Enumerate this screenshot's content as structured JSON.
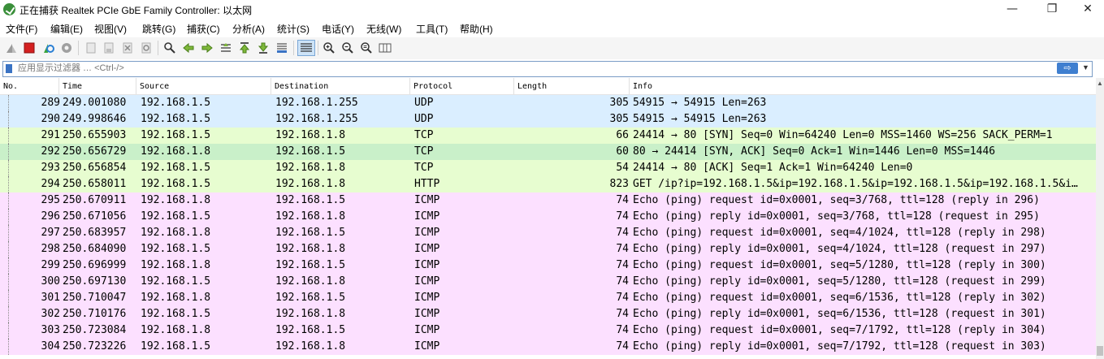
{
  "window": {
    "title": "正在捕获 Realtek PCIe GbE Family Controller: 以太网",
    "minimize_glyph": "—",
    "maximize_glyph": "❐",
    "close_glyph": "✕"
  },
  "menubar": {
    "items": [
      "文件(F)",
      "编辑(E)",
      "视图(V)",
      "跳转(G)",
      "捕获(C)",
      "分析(A)",
      "统计(S)",
      "电话(Y)",
      "无线(W)",
      "工具(T)",
      "帮助(H)"
    ]
  },
  "toolbar": {
    "icons": [
      "shark-fin-start-icon",
      "stop-capture-icon",
      "restart-capture-icon",
      "capture-options-icon",
      "open-file-icon",
      "save-file-icon",
      "close-file-icon",
      "reload-file-icon",
      "find-packet-icon",
      "go-back-icon",
      "go-forward-icon",
      "go-to-packet-icon",
      "go-first-icon",
      "go-last-icon",
      "auto-scroll-icon",
      "colorize-icon",
      "zoom-in-icon",
      "zoom-out-icon",
      "zoom-normal-icon",
      "resize-columns-icon"
    ]
  },
  "filter": {
    "placeholder": "应用显示过滤器 … <Ctrl-/>",
    "apply_glyph": "⇨",
    "dropdown_glyph": "▼"
  },
  "packet_list": {
    "columns": [
      "No.",
      "Time",
      "Source",
      "Destination",
      "Protocol",
      "Length",
      "Info"
    ],
    "colors": {
      "udp": "#daeeff",
      "tcp": "#e7fdd0",
      "tcp_selected": "#c9f0c9",
      "icmp": "#fce0ff"
    },
    "rows": [
      {
        "no": "289",
        "time": "249.001080",
        "src": "192.168.1.5",
        "dst": "192.168.1.255",
        "proto": "UDP",
        "len": "305",
        "info": "54915 → 54915 Len=263",
        "color": "#daeeff"
      },
      {
        "no": "290",
        "time": "249.998646",
        "src": "192.168.1.5",
        "dst": "192.168.1.255",
        "proto": "UDP",
        "len": "305",
        "info": "54915 → 54915 Len=263",
        "color": "#daeeff"
      },
      {
        "no": "291",
        "time": "250.655903",
        "src": "192.168.1.5",
        "dst": "192.168.1.8",
        "proto": "TCP",
        "len": "66",
        "info": "24414 → 80 [SYN] Seq=0 Win=64240 Len=0 MSS=1460 WS=256 SACK_PERM=1",
        "color": "#e7fdd0"
      },
      {
        "no": "292",
        "time": "250.656729",
        "src": "192.168.1.8",
        "dst": "192.168.1.5",
        "proto": "TCP",
        "len": "60",
        "info": "80 → 24414 [SYN, ACK] Seq=0 Ack=1 Win=1446 Len=0 MSS=1446",
        "color": "#c9f0c9"
      },
      {
        "no": "293",
        "time": "250.656854",
        "src": "192.168.1.5",
        "dst": "192.168.1.8",
        "proto": "TCP",
        "len": "54",
        "info": "24414 → 80 [ACK] Seq=1 Ack=1 Win=64240 Len=0",
        "color": "#e7fdd0"
      },
      {
        "no": "294",
        "time": "250.658011",
        "src": "192.168.1.5",
        "dst": "192.168.1.8",
        "proto": "HTTP",
        "len": "823",
        "info": "GET /ip?ip=192.168.1.5&ip=192.168.1.5&ip=192.168.1.5&ip=192.168.1.5&i…",
        "color": "#e7fdd0"
      },
      {
        "no": "295",
        "time": "250.670911",
        "src": "192.168.1.8",
        "dst": "192.168.1.5",
        "proto": "ICMP",
        "len": "74",
        "info": "Echo (ping) request  id=0x0001, seq=3/768, ttl=128 (reply in 296)",
        "color": "#fce0ff"
      },
      {
        "no": "296",
        "time": "250.671056",
        "src": "192.168.1.5",
        "dst": "192.168.1.8",
        "proto": "ICMP",
        "len": "74",
        "info": "Echo (ping) reply    id=0x0001, seq=3/768, ttl=128 (request in 295)",
        "color": "#fce0ff"
      },
      {
        "no": "297",
        "time": "250.683957",
        "src": "192.168.1.8",
        "dst": "192.168.1.5",
        "proto": "ICMP",
        "len": "74",
        "info": "Echo (ping) request  id=0x0001, seq=4/1024, ttl=128 (reply in 298)",
        "color": "#fce0ff"
      },
      {
        "no": "298",
        "time": "250.684090",
        "src": "192.168.1.5",
        "dst": "192.168.1.8",
        "proto": "ICMP",
        "len": "74",
        "info": "Echo (ping) reply    id=0x0001, seq=4/1024, ttl=128 (request in 297)",
        "color": "#fce0ff"
      },
      {
        "no": "299",
        "time": "250.696999",
        "src": "192.168.1.8",
        "dst": "192.168.1.5",
        "proto": "ICMP",
        "len": "74",
        "info": "Echo (ping) request  id=0x0001, seq=5/1280, ttl=128 (reply in 300)",
        "color": "#fce0ff"
      },
      {
        "no": "300",
        "time": "250.697130",
        "src": "192.168.1.5",
        "dst": "192.168.1.8",
        "proto": "ICMP",
        "len": "74",
        "info": "Echo (ping) reply    id=0x0001, seq=5/1280, ttl=128 (request in 299)",
        "color": "#fce0ff"
      },
      {
        "no": "301",
        "time": "250.710047",
        "src": "192.168.1.8",
        "dst": "192.168.1.5",
        "proto": "ICMP",
        "len": "74",
        "info": "Echo (ping) request  id=0x0001, seq=6/1536, ttl=128 (reply in 302)",
        "color": "#fce0ff"
      },
      {
        "no": "302",
        "time": "250.710176",
        "src": "192.168.1.5",
        "dst": "192.168.1.8",
        "proto": "ICMP",
        "len": "74",
        "info": "Echo (ping) reply    id=0x0001, seq=6/1536, ttl=128 (request in 301)",
        "color": "#fce0ff"
      },
      {
        "no": "303",
        "time": "250.723084",
        "src": "192.168.1.8",
        "dst": "192.168.1.5",
        "proto": "ICMP",
        "len": "74",
        "info": "Echo (ping) request  id=0x0001, seq=7/1792, ttl=128 (reply in 304)",
        "color": "#fce0ff"
      },
      {
        "no": "304",
        "time": "250.723226",
        "src": "192.168.1.5",
        "dst": "192.168.1.8",
        "proto": "ICMP",
        "len": "74",
        "info": "Echo (ping) reply    id=0x0001, seq=7/1792, ttl=128 (request in 303)",
        "color": "#fce0ff"
      }
    ]
  }
}
